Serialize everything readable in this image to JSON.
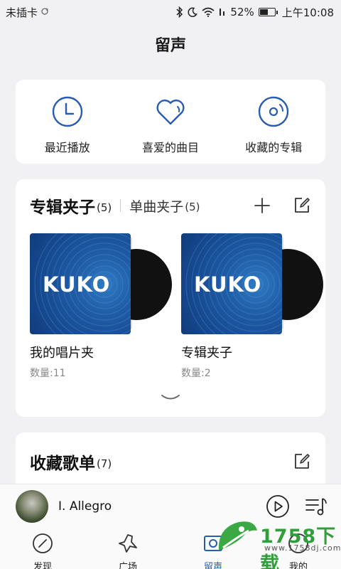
{
  "status_bar": {
    "carrier": "未插卡",
    "battery": "52%",
    "time": "上午10:08"
  },
  "page_title": "留声",
  "quick_actions": [
    {
      "label": "最近播放",
      "icon": "clock-icon"
    },
    {
      "label": "喜爱的曲目",
      "icon": "heart-icon"
    },
    {
      "label": "收藏的专辑",
      "icon": "disc-icon"
    }
  ],
  "folders": {
    "tab_active": "专辑夹子",
    "tab_active_count": "(5)",
    "tab_inactive": "单曲夹子",
    "tab_inactive_count": "(5)",
    "items": [
      {
        "name": "我的唱片夹",
        "qty": "数量:11",
        "cover_text": "KUKO"
      },
      {
        "name": "专辑夹子",
        "qty": "数量:2",
        "cover_text": "KUKO"
      }
    ]
  },
  "playlists": {
    "title": "收藏歌单",
    "count": "(7)"
  },
  "player": {
    "track": "I. Allegro"
  },
  "nav": [
    {
      "label": "发现",
      "icon": "compass-icon"
    },
    {
      "label": "广场",
      "icon": "plaza-icon"
    },
    {
      "label": "留声",
      "icon": "record-player-icon"
    },
    {
      "label": "我的",
      "icon": "profile-icon"
    }
  ],
  "watermark": {
    "text": "1758下载",
    "url": "www.1758dj.com"
  },
  "colors": {
    "accent": "#2a5cae",
    "background": "#f1f1f3"
  }
}
